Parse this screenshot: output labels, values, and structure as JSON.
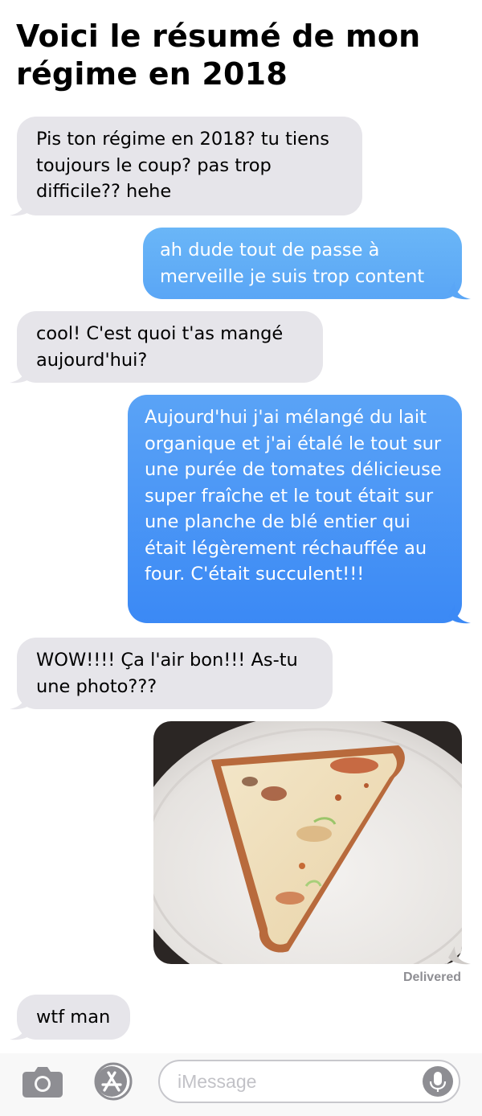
{
  "title": "Voici le résumé de mon régime en 2018",
  "colors": {
    "received_bubble": "#e6e5ea",
    "sent_bubble_top": "#6cb4f7",
    "sent_bubble_bottom": "#3d8ef7",
    "background": "#ffffff",
    "delivered_text": "#8e8e93"
  },
  "messages": [
    {
      "direction": "received",
      "text": "Pis ton régime en 2018? tu tiens toujours le coup? pas trop difficile?? hehe"
    },
    {
      "direction": "sent",
      "text": "ah dude tout de passe à merveille je suis trop content"
    },
    {
      "direction": "received",
      "text": "cool! C'est quoi t'as mangé aujourd'hui?"
    },
    {
      "direction": "sent",
      "text": "Aujourd'hui j'ai mélangé du lait organique et j'ai étalé le tout sur une purée de tomates délicieuse super fraîche et le tout était sur une planche de blé entier qui était légèrement réchauffée au four. C'était succulent!!!"
    },
    {
      "direction": "received",
      "text": "WOW!!!! Ça l'air bon!!! As-tu une photo???"
    },
    {
      "direction": "sent",
      "type": "photo"
    },
    {
      "direction": "received",
      "text": "wtf man"
    }
  ],
  "status": {
    "delivered": "Delivered"
  },
  "compose": {
    "placeholder": "iMessage",
    "camera_icon": "camera-icon",
    "appstore_icon": "app-store-icon",
    "mic_icon": "microphone-icon"
  }
}
